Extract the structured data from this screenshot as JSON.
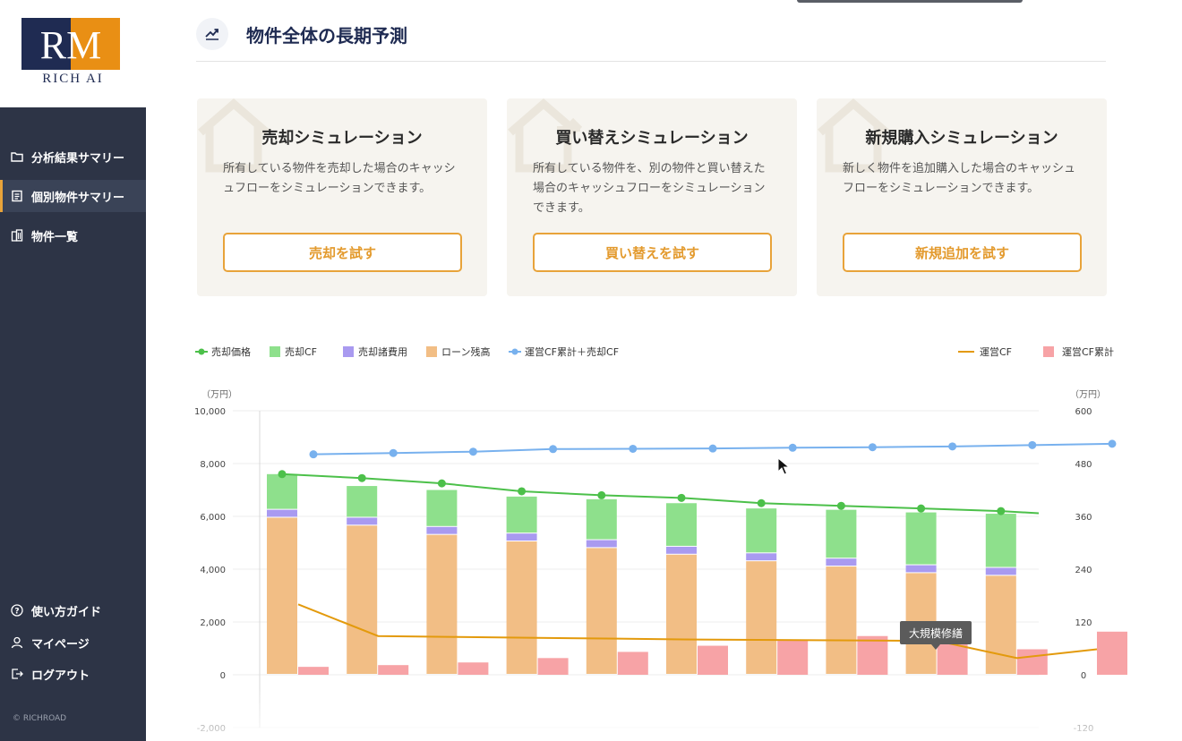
{
  "sidebar": {
    "logo_text": "RICH AI",
    "items": [
      {
        "label": "分析結果サマリー",
        "icon": "folder-icon"
      },
      {
        "label": "個別物件サマリー",
        "icon": "document-icon"
      },
      {
        "label": "物件一覧",
        "icon": "building-icon"
      }
    ],
    "bottom_items": [
      {
        "label": "使い方ガイド",
        "icon": "help-icon"
      },
      {
        "label": "マイページ",
        "icon": "user-icon"
      },
      {
        "label": "ログアウト",
        "icon": "logout-icon"
      }
    ],
    "copyright": "© RICHROAD"
  },
  "header": {
    "title": "物件全体の長期予測",
    "icon": "trend-icon"
  },
  "cards": [
    {
      "title": "売却シミュレーション",
      "description": "所有している物件を売却した場合のキャッシュフローをシミュレーションできます。",
      "button": "売却を試す"
    },
    {
      "title": "買い替えシミュレーション",
      "description": "所有している物件を、別の物件と買い替えた場合のキャッシュフローをシミュレーションできます。",
      "button": "買い替えを試す"
    },
    {
      "title": "新規購入シミュレーション",
      "description": "新しく物件を追加購入した場合のキャッシュフローをシミュレーションできます。",
      "button": "新規追加を試す"
    }
  ],
  "chart_data": {
    "type": "bar",
    "left_unit": "（万円）",
    "right_unit": "（万円）",
    "ylim": [
      -2000,
      10000
    ],
    "y_ticks": [
      "10,000",
      "8,000",
      "6,000",
      "4,000",
      "2,000",
      "0",
      "-2,000"
    ],
    "y2lim": [
      -120,
      600
    ],
    "y2_ticks": [
      "600",
      "480",
      "360",
      "240",
      "120",
      "0",
      "-120"
    ],
    "legend_left": [
      {
        "name": "売却価格",
        "color": "#4cc04a",
        "kind": "line-dot"
      },
      {
        "name": "売却CF",
        "color": "#8ee08c",
        "kind": "box"
      },
      {
        "name": "売却諸費用",
        "color": "#a99af0",
        "kind": "box"
      },
      {
        "name": "ローン残高",
        "color": "#f2be85",
        "kind": "box"
      },
      {
        "name": "運営CF累計＋売却CF",
        "color": "#78b1ee",
        "kind": "line-dot"
      }
    ],
    "legend_right": [
      {
        "name": "運営CF",
        "color": "#e39a0c",
        "kind": "line"
      },
      {
        "name": "運営CF累計",
        "color": "#f7a3a6",
        "kind": "box"
      }
    ],
    "series": {
      "sale_price": {
        "name": "売却価格",
        "color": "#4cc04a",
        "values": [
          7600,
          7450,
          7250,
          6950,
          6800,
          6700,
          6500,
          6400,
          6300,
          6200
        ]
      },
      "loan_balance": {
        "name": "ローン残高",
        "color": "#f2be85",
        "values": [
          5950,
          5650,
          5300,
          5050,
          4800,
          4550,
          4300,
          4100,
          3850,
          3750
        ]
      },
      "sale_cost": {
        "name": "売却諸費用",
        "color": "#a99af0",
        "values": [
          300,
          300,
          300,
          300,
          300,
          300,
          300,
          300,
          300,
          300
        ]
      },
      "sale_cf": {
        "name": "売却CF",
        "color": "#8ee08c",
        "values": [
          1350,
          1200,
          1400,
          1400,
          1550,
          1650,
          1700,
          1850,
          2000,
          2050
        ]
      },
      "cumulative_plus_sale": {
        "name": "運営CF累計＋売却CF",
        "color": "#78b1ee",
        "values": [
          8350,
          8400,
          8450,
          8550,
          8560,
          8570,
          8600,
          8620,
          8650,
          8700,
          8750
        ]
      },
      "operating_cf": {
        "name": "運営CF",
        "color": "#e39a0c",
        "values": [
          160,
          88,
          86,
          84,
          82,
          80,
          79,
          78,
          77,
          38,
          58
        ]
      },
      "operating_cf_cumulative": {
        "name": "運営CF累計",
        "color": "#f7a3a6",
        "values": [
          18,
          22,
          28,
          38,
          52,
          66,
          78,
          88,
          72,
          58,
          98
        ]
      }
    },
    "annotation": "大規模修繕"
  }
}
